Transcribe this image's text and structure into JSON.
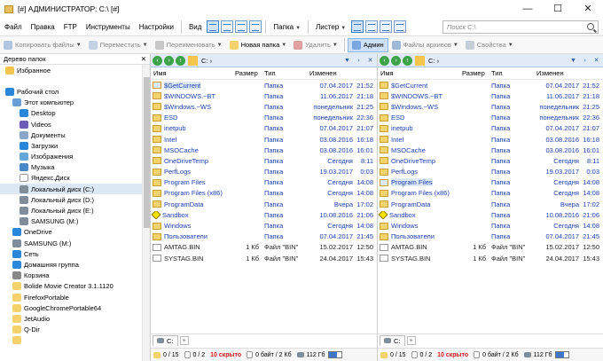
{
  "window": {
    "title": "[#] АДМИНИСТРАТОР: C:\\ [#]",
    "minimize": "—",
    "maximize": "☐",
    "close": "✕"
  },
  "menu": {
    "items": [
      "Файл",
      "Правка",
      "FTP",
      "Инструменты",
      "Настройки"
    ],
    "view": "Вид",
    "folder": "Папка",
    "lister": "Листер",
    "search_placeholder": "Поиск C:\\"
  },
  "toolbar": {
    "copy": "Копировать файлы",
    "move": "Переместить",
    "rename": "Переименовать",
    "new_folder": "Новая папка",
    "delete": "Удалить",
    "admin": "Админ",
    "archives": "Файлы архивов",
    "properties": "Свойства"
  },
  "tree": {
    "header": "Дерево папок",
    "close": "✕",
    "items": [
      {
        "label": "Избранное",
        "indent": 0,
        "icon": "star-icon",
        "color": "#f3c54d"
      },
      {
        "label": "",
        "indent": 0,
        "icon": "",
        "color": ""
      },
      {
        "label": "Рабочий стол",
        "indent": 0,
        "icon": "desktop-icon",
        "color": "#2a86d8"
      },
      {
        "label": "Этот компьютер",
        "indent": 1,
        "icon": "computer-icon",
        "color": "#6a9fd6"
      },
      {
        "label": "Desktop",
        "indent": 2,
        "icon": "desktop-icon",
        "color": "#2a86d8"
      },
      {
        "label": "Videos",
        "indent": 2,
        "icon": "videos-icon",
        "color": "#6d5bb5"
      },
      {
        "label": "Документы",
        "indent": 2,
        "icon": "documents-icon",
        "color": "#8aa6c8"
      },
      {
        "label": "Загрузки",
        "indent": 2,
        "icon": "downloads-icon",
        "color": "#2a86d8"
      },
      {
        "label": "Изображения",
        "indent": 2,
        "icon": "pictures-icon",
        "color": "#64a8d8"
      },
      {
        "label": "Музыка",
        "indent": 2,
        "icon": "music-icon",
        "color": "#4a88c8"
      },
      {
        "label": "Яндекс.Диск",
        "indent": 2,
        "icon": "yandex-disk-icon",
        "color": "#ffffff"
      },
      {
        "label": "Локальный диск (C:)",
        "indent": 2,
        "icon": "drive-icon",
        "color": "#7f8c99",
        "selected": true
      },
      {
        "label": "Локальный диск (D:)",
        "indent": 2,
        "icon": "drive-icon",
        "color": "#7f8c99"
      },
      {
        "label": "Локальный диск (E:)",
        "indent": 2,
        "icon": "drive-icon",
        "color": "#7f8c99"
      },
      {
        "label": "SAMSUNG (M:)",
        "indent": 2,
        "icon": "usb-drive-icon",
        "color": "#7f8c99"
      },
      {
        "label": "OneDrive",
        "indent": 1,
        "icon": "onedrive-icon",
        "color": "#2a86d8"
      },
      {
        "label": "SAMSUNG (M:)",
        "indent": 1,
        "icon": "usb-drive-icon",
        "color": "#7f8c99"
      },
      {
        "label": "Сеть",
        "indent": 1,
        "icon": "network-icon",
        "color": "#2a86d8"
      },
      {
        "label": "Домашняя группа",
        "indent": 1,
        "icon": "homegroup-icon",
        "color": "#2a86d8"
      },
      {
        "label": "Корзина",
        "indent": 1,
        "icon": "recycle-bin-icon",
        "color": "#888888"
      },
      {
        "label": "Bolide Movie Creator 3.1.1120",
        "indent": 1,
        "icon": "folder-icon",
        "color": "#f5d36c"
      },
      {
        "label": "FirefoxPortable",
        "indent": 1,
        "icon": "folder-icon",
        "color": "#f5d36c"
      },
      {
        "label": "GoogleChromePortable64",
        "indent": 1,
        "icon": "folder-icon",
        "color": "#f5d36c"
      },
      {
        "label": "JetAudio",
        "indent": 1,
        "icon": "folder-icon",
        "color": "#f5d36c"
      },
      {
        "label": "Q-Dir",
        "indent": 1,
        "icon": "folder-icon",
        "color": "#f5d36c"
      },
      {
        "label": "",
        "indent": 1,
        "icon": "folder-icon",
        "color": "#f5d36c"
      }
    ]
  },
  "columns": {
    "name": "Имя",
    "size": "Размер",
    "type": "Тип",
    "modified": "Изменен"
  },
  "panes": [
    {
      "path": "C: ›",
      "highlight": 0,
      "tab": "C:",
      "status": {
        "count": "0 / 15",
        "files": "0 / 2",
        "hidden": "10 скрыто",
        "bytes": "0 байт / 2 Кб",
        "free": "112 Гб",
        "free_fraction": 0.7
      },
      "rows": [
        {
          "name": "$GetCurrent",
          "size": "",
          "type": "Папка",
          "date": "07.04.2017",
          "time": "21:52",
          "kind": "folder",
          "blue": true
        },
        {
          "name": "$WINDOWS.~BT",
          "size": "",
          "type": "Папка",
          "date": "11.06.2017",
          "time": "21:18",
          "kind": "folder",
          "blue": true
        },
        {
          "name": "$Windows.~WS",
          "size": "",
          "type": "Папка",
          "date": "понедельник",
          "time": "21:25",
          "kind": "folder",
          "blue": true
        },
        {
          "name": "ESD",
          "size": "",
          "type": "Папка",
          "date": "понедельник",
          "time": "22:36",
          "kind": "folder",
          "blue": true
        },
        {
          "name": "inetpub",
          "size": "",
          "type": "Папка",
          "date": "07.04.2017",
          "time": "21:07",
          "kind": "folder",
          "blue": true
        },
        {
          "name": "Intel",
          "size": "",
          "type": "Папка",
          "date": "03.08.2016",
          "time": "16:18",
          "kind": "folder",
          "blue": true
        },
        {
          "name": "MSOCache",
          "size": "",
          "type": "Папка",
          "date": "03.08.2016",
          "time": "16:01",
          "kind": "folder",
          "blue": true
        },
        {
          "name": "OneDriveTemp",
          "size": "",
          "type": "Папка",
          "date": "Сегодня",
          "time": "8:11",
          "kind": "folder",
          "blue": true
        },
        {
          "name": "PerfLogs",
          "size": "",
          "type": "Папка",
          "date": "19.03.2017",
          "time": "0:03",
          "kind": "folder",
          "blue": true
        },
        {
          "name": "Program Files",
          "size": "",
          "type": "Папка",
          "date": "Сегодня",
          "time": "14:08",
          "kind": "folder",
          "blue": true
        },
        {
          "name": "Program Files (x86)",
          "size": "",
          "type": "Папка",
          "date": "Сегодня",
          "time": "14:08",
          "kind": "folder",
          "blue": true
        },
        {
          "name": "ProgramData",
          "size": "",
          "type": "Папка",
          "date": "Вчера",
          "time": "17:02",
          "kind": "folder",
          "blue": true
        },
        {
          "name": "Sandbox",
          "size": "",
          "type": "Папка",
          "date": "10.08.2016",
          "time": "21:06",
          "kind": "sandbox",
          "blue": true
        },
        {
          "name": "Windows",
          "size": "",
          "type": "Папка",
          "date": "Сегодня",
          "time": "14:08",
          "kind": "folder",
          "blue": true
        },
        {
          "name": "Пользователи",
          "size": "",
          "type": "Папка",
          "date": "07.04.2017",
          "time": "21:45",
          "kind": "folder",
          "blue": true
        },
        {
          "name": "AMTAG.BIN",
          "size": "1 Кб",
          "type": "Файл \"BIN\"",
          "date": "15.02.2017",
          "time": "12:50",
          "kind": "file",
          "blue": false
        },
        {
          "name": "SYSTAG.BIN",
          "size": "1 Кб",
          "type": "Файл \"BIN\"",
          "date": "24.04.2017",
          "time": "15:43",
          "kind": "file",
          "blue": false
        }
      ]
    },
    {
      "path": "C: ›",
      "highlight": 9,
      "tab": "C:",
      "status": {
        "count": "0 / 15",
        "files": "0 / 2",
        "hidden": "10 скрыто",
        "bytes": "0 байт / 2 Кб",
        "free": "112 Гб",
        "free_fraction": 0.7
      },
      "rows": [
        {
          "name": "$GetCurrent",
          "size": "",
          "type": "Папка",
          "date": "07.04.2017",
          "time": "21:52",
          "kind": "folder",
          "blue": true
        },
        {
          "name": "$WINDOWS.~BT",
          "size": "",
          "type": "Папка",
          "date": "11.06.2017",
          "time": "21:18",
          "kind": "folder",
          "blue": true
        },
        {
          "name": "$Windows.~WS",
          "size": "",
          "type": "Папка",
          "date": "понедельник",
          "time": "21:25",
          "kind": "folder",
          "blue": true
        },
        {
          "name": "ESD",
          "size": "",
          "type": "Папка",
          "date": "понедельник",
          "time": "22:36",
          "kind": "folder",
          "blue": true
        },
        {
          "name": "inetpub",
          "size": "",
          "type": "Папка",
          "date": "07.04.2017",
          "time": "21:07",
          "kind": "folder",
          "blue": true
        },
        {
          "name": "Intel",
          "size": "",
          "type": "Папка",
          "date": "03.08.2016",
          "time": "16:18",
          "kind": "folder",
          "blue": true
        },
        {
          "name": "MSOCache",
          "size": "",
          "type": "Папка",
          "date": "03.08.2016",
          "time": "16:01",
          "kind": "folder",
          "blue": true
        },
        {
          "name": "OneDriveTemp",
          "size": "",
          "type": "Папка",
          "date": "Сегодня",
          "time": "8:11",
          "kind": "folder",
          "blue": true
        },
        {
          "name": "PerfLogs",
          "size": "",
          "type": "Папка",
          "date": "19.03.2017",
          "time": "0:03",
          "kind": "folder",
          "blue": true
        },
        {
          "name": "Program Files",
          "size": "",
          "type": "Папка",
          "date": "Сегодня",
          "time": "14:08",
          "kind": "folder",
          "blue": true
        },
        {
          "name": "Program Files (x86)",
          "size": "",
          "type": "Папка",
          "date": "Сегодня",
          "time": "14:08",
          "kind": "folder",
          "blue": true
        },
        {
          "name": "ProgramData",
          "size": "",
          "type": "Папка",
          "date": "Вчера",
          "time": "17:02",
          "kind": "folder",
          "blue": true
        },
        {
          "name": "Sandbox",
          "size": "",
          "type": "Папка",
          "date": "10.08.2016",
          "time": "21:06",
          "kind": "sandbox",
          "blue": true
        },
        {
          "name": "Windows",
          "size": "",
          "type": "Папка",
          "date": "Сегодня",
          "time": "14:08",
          "kind": "folder",
          "blue": true
        },
        {
          "name": "Пользователи",
          "size": "",
          "type": "Папка",
          "date": "07.04.2017",
          "time": "21:45",
          "kind": "folder",
          "blue": true
        },
        {
          "name": "AMTAG.BIN",
          "size": "1 Кб",
          "type": "Файл \"BIN\"",
          "date": "15.02.2017",
          "time": "12:50",
          "kind": "file",
          "blue": false
        },
        {
          "name": "SYSTAG.BIN",
          "size": "1 Кб",
          "type": "Файл \"BIN\"",
          "date": "24.04.2017",
          "time": "15:43",
          "kind": "file",
          "blue": false
        }
      ]
    }
  ]
}
